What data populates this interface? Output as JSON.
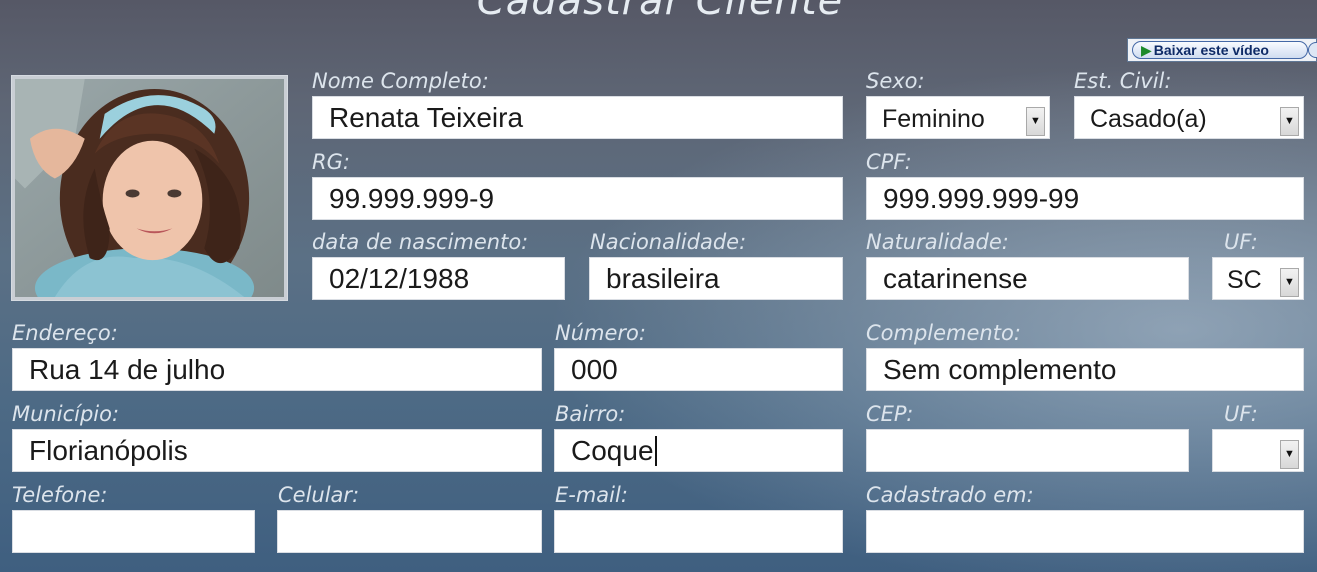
{
  "form": {
    "title": "Cadastrar Cliente",
    "video_button": "Baixar este vídeo",
    "labels": {
      "nome": "Nome Completo:",
      "sexo": "Sexo:",
      "estado_civil": "Est. Civil:",
      "rg": "RG:",
      "cpf": "CPF:",
      "nascimento": "data de nascimento:",
      "nacionalidade": "Nacionalidade:",
      "naturalidade": "Naturalidade:",
      "uf1": "UF:",
      "endereco": "Endereço:",
      "numero": "Número:",
      "complemento": "Complemento:",
      "municipio": "Município:",
      "bairro": "Bairro:",
      "cep": "CEP:",
      "uf2": "UF:",
      "telefone": "Telefone:",
      "celular": "Celular:",
      "email": "E-mail:",
      "cadastrado_em": "Cadastrado em:"
    },
    "values": {
      "nome": "Renata Teixeira",
      "sexo": "Feminino",
      "estado_civil": "Casado(a)",
      "rg": "99.999.999-9",
      "cpf": "999.999.999-99",
      "nascimento": "02/12/1988",
      "nacionalidade": "brasileira",
      "naturalidade": "catarinense",
      "uf1": "SC",
      "endereco": "Rua 14 de julho",
      "numero": "000",
      "complemento": "Sem complemento",
      "municipio": "Florianópolis",
      "bairro": "Coque",
      "cep": "",
      "uf2": "",
      "telefone": "",
      "celular": "",
      "email": "",
      "cadastrado_em": ""
    },
    "dropdown_icon": "dropdown-arrow-icon",
    "colors": {
      "background_top": "#565866",
      "background_bottom": "#3f5f80",
      "label_text": "#dce4ec",
      "field_bg": "#ffffff"
    }
  }
}
